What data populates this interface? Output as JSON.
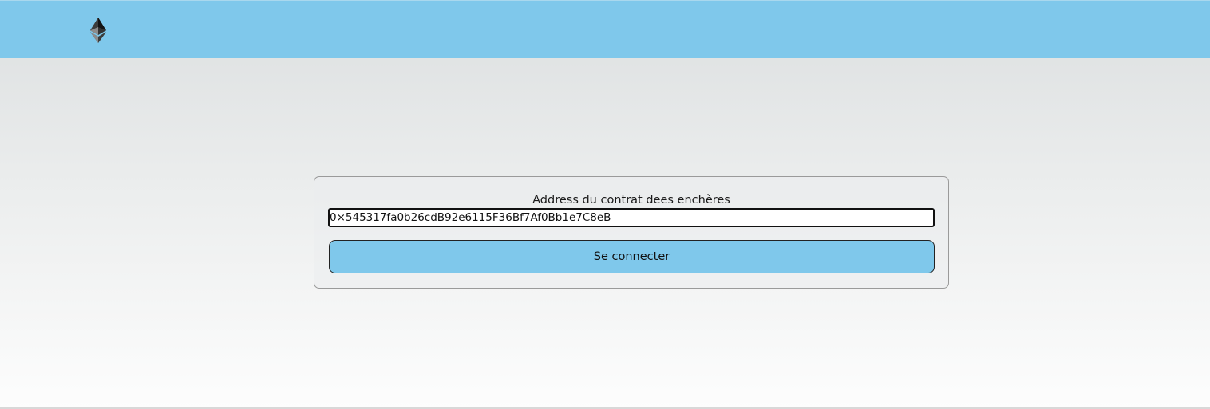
{
  "header": {
    "logo_icon": "ethereum-logo-icon",
    "background_color": "#7fc8eb"
  },
  "connect_form": {
    "label": "Address du contrat dees enchères",
    "address_value": "0×545317fa0b26cdB92e6115F36Bf7Af0Bb1e7C8eB",
    "button_label": "Se connecter",
    "button_color": "#7fc8eb"
  }
}
